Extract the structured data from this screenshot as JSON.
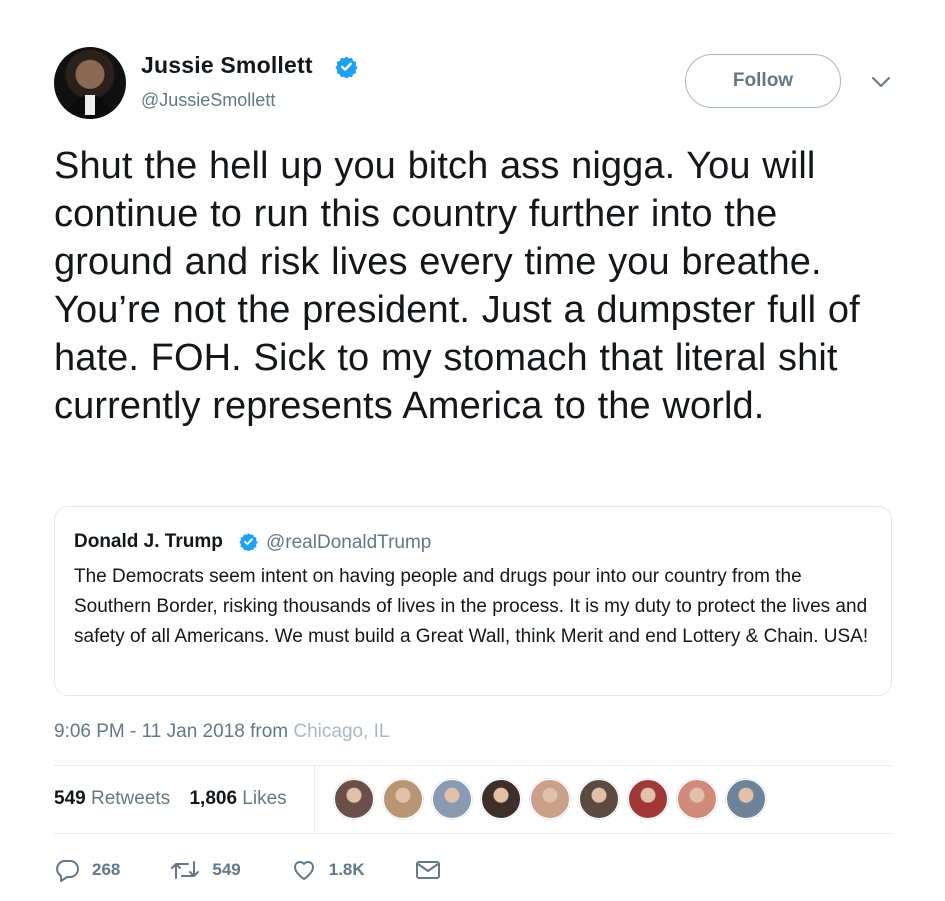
{
  "author": {
    "name": "Jussie Smollett",
    "handle": "@JussieSmollett",
    "verified": true
  },
  "follow_button": {
    "label": "Follow"
  },
  "tweet": {
    "text": "Shut the hell up you bitch ass nigga. You will continue to run this country further into the ground and risk lives every time you breathe. You’re not the president. Just a dumpster full of hate. FOH. Sick to my stomach that literal shit currently represents America to the world."
  },
  "quoted_tweet": {
    "name": "Donald J. Trump",
    "handle": "@realDonaldTrump",
    "verified": true,
    "text": "The Democrats seem intent on having people and drugs pour into our country from the Southern Border, risking thousands of lives in the process. It is my duty to protect the lives and safety of all Americans. We must build a Great Wall, think Merit and end Lottery & Chain. USA!"
  },
  "meta": {
    "time": "9:06 PM - 11 Jan 2018",
    "from_label": "from",
    "location": "Chicago, IL"
  },
  "stats": {
    "retweets_count": "549",
    "retweets_label": "Retweets",
    "likes_count": "1,806",
    "likes_label": "Likes"
  },
  "liker_avatars": [
    {
      "color": "#6b4f4a"
    },
    {
      "color": "#b89575"
    },
    {
      "color": "#8a9ab0"
    },
    {
      "color": "#3d2f2a"
    },
    {
      "color": "#c9a08a"
    },
    {
      "color": "#5a4a42"
    },
    {
      "color": "#a0383a"
    },
    {
      "color": "#d08a7a"
    },
    {
      "color": "#6f8398"
    }
  ],
  "actions": {
    "reply_count": "268",
    "retweet_count": "549",
    "like_count": "1.8K"
  },
  "colors": {
    "verified": "#1da1f2",
    "secondary_text": "#657786",
    "border": "#e1e8ed"
  }
}
